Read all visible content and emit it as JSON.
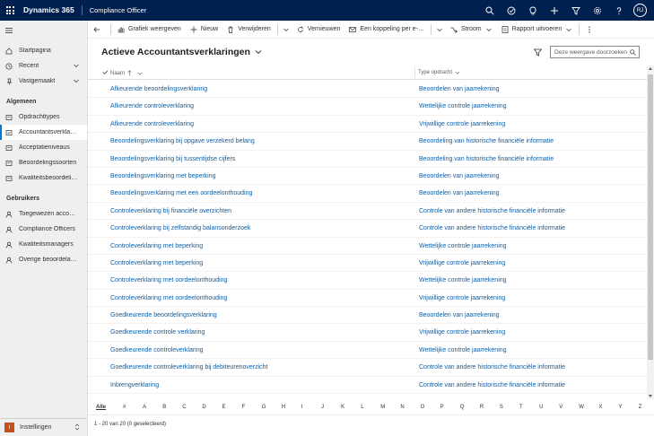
{
  "topbar": {
    "brand": "Dynamics 365",
    "app": "Compliance Officer",
    "avatar": "RJ",
    "icons": [
      "search-icon",
      "task-icon",
      "lightbulb-icon",
      "add-icon",
      "filter-icon",
      "settings-icon",
      "help-icon"
    ]
  },
  "sidebar": {
    "top": [
      {
        "label": "Startpagina",
        "icon": "home-icon"
      },
      {
        "label": "Recent",
        "icon": "clock-icon"
      },
      {
        "label": "Vastgemaakt",
        "icon": "pin-icon"
      }
    ],
    "groups": [
      {
        "title": "Algemeen",
        "items": [
          {
            "label": "Opdrachttypes",
            "icon": "entity-icon"
          },
          {
            "label": "Accountantsverklarin…",
            "icon": "entity-icon",
            "active": true
          },
          {
            "label": "Acceptatieniveaus",
            "icon": "entity-icon"
          },
          {
            "label": "Beoordelingssoorten",
            "icon": "entity-icon"
          },
          {
            "label": "Kwaliteitsbeoordelin…",
            "icon": "entity-icon"
          }
        ]
      },
      {
        "title": "Gebruikers",
        "items": [
          {
            "label": "Toegewezen account…",
            "icon": "person-icon"
          },
          {
            "label": "Compliance Officers",
            "icon": "person-icon"
          },
          {
            "label": "Kwaliteitsmanagers",
            "icon": "person-icon"
          },
          {
            "label": "Overige beoordelaars",
            "icon": "person-icon"
          }
        ]
      }
    ],
    "area": {
      "initial": "I",
      "label": "Instellingen"
    }
  },
  "commands": [
    {
      "label": "",
      "icon": "back-arrow-icon"
    },
    {
      "label": "Grafiek weergeven",
      "icon": "chart-icon"
    },
    {
      "label": "Nieuw",
      "icon": "plus-icon"
    },
    {
      "label": "Verwijderen",
      "icon": "trash-icon"
    },
    {
      "label": "Vernieuwen",
      "icon": "refresh-icon"
    },
    {
      "label": "Een koppeling per e-…",
      "icon": "email-link-icon"
    },
    {
      "label": "Stroom",
      "icon": "flow-icon"
    },
    {
      "label": "Rapport uitvoeren",
      "icon": "report-icon"
    }
  ],
  "view": {
    "title": "Actieve Accountantsverklaringen",
    "search_placeholder": "Deze weergave doorzoeken"
  },
  "grid": {
    "columns": [
      "Naam",
      "Type opdracht"
    ],
    "rows": [
      [
        "Afkeurende beoordelingsverklaring",
        "Beoordelen van jaarrekening"
      ],
      [
        "Afkeurende controleverklaring",
        "Wettelijke controle jaarrekening"
      ],
      [
        "Afkeurende controleverklaring",
        "Vrijwillige controle jaarrekening"
      ],
      [
        "Beoordelingsverklaring bij opgave verzekerd belang",
        "Beoordeling van historische financiële informatie"
      ],
      [
        "Beoordelingsverklaring bij tussentijdse cijfers",
        "Beoordeling van historische financiële informatie"
      ],
      [
        "Beoordelingsverklaring met beperking",
        "Beoordelen van jaarrekening"
      ],
      [
        "Beoordelingsverklaring met een oordeelonthouding",
        "Beoordelen van jaarrekening"
      ],
      [
        "Controleverklaring bij financiële overzichten",
        "Controle van andere historische financiële informatie"
      ],
      [
        "Controleverklaring bij zelfstandig balansonderzoek",
        "Controle van andere historische financiële informatie"
      ],
      [
        "Controleverklaring met beperking",
        "Wettelijke controle jaarrekening"
      ],
      [
        "Controleverklaring met beperking",
        "Vrijwillige controle jaarrekening"
      ],
      [
        "Controleverklaring met oordeelonthouding",
        "Wettelijke controle jaarrekening"
      ],
      [
        "Controleverklaring met oordeelonthouding",
        "Vrijwillige controle jaarrekening"
      ],
      [
        "Goedkeurende beoordelingsverklaring",
        "Beoordelen van jaarrekening"
      ],
      [
        "Goedkeurende controle verklaring",
        "Vrijwillige controle jaarrekening"
      ],
      [
        "Goedkeurende controleverklaring",
        "Wettelijke controle jaarrekening"
      ],
      [
        "Goedkeurende controleverklaring bij debiteurenoverzicht",
        "Controle van andere historische financiële informatie"
      ],
      [
        "Inbrengverklaring",
        "Controle van andere historische financiële informatie"
      ]
    ]
  },
  "alphabet": [
    "Alle",
    "#",
    "A",
    "B",
    "C",
    "D",
    "E",
    "F",
    "G",
    "H",
    "I",
    "J",
    "K",
    "L",
    "M",
    "N",
    "O",
    "P",
    "Q",
    "R",
    "S",
    "T",
    "U",
    "V",
    "W",
    "X",
    "Y",
    "Z"
  ],
  "status": "1 - 20 van 20 (0 geselecteerd)"
}
